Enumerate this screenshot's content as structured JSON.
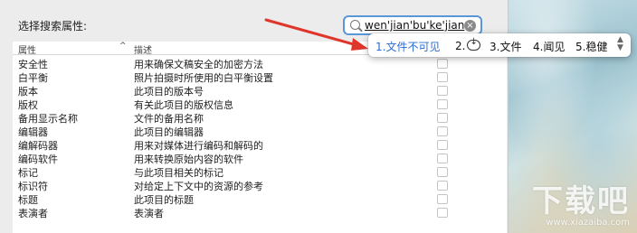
{
  "dialog": {
    "title": "选择搜索属性:",
    "search": {
      "query": "wen'jian'bu'ke'jian"
    },
    "table": {
      "columns": [
        "属性",
        "描述"
      ],
      "sort_glyph": "^",
      "rows": [
        {
          "attr": "安全性",
          "desc": "用来确保文稿安全的加密方法"
        },
        {
          "attr": "白平衡",
          "desc": "照片拍摄时所使用的白平衡设置"
        },
        {
          "attr": "版本",
          "desc": "此项目的版本号"
        },
        {
          "attr": "版权",
          "desc": "有关此项目的版权信息"
        },
        {
          "attr": "备用显示名称",
          "desc": "文件的备用名称"
        },
        {
          "attr": "编辑器",
          "desc": "此项目的编辑器"
        },
        {
          "attr": "编解码器",
          "desc": "用来对媒体进行编码和解码的"
        },
        {
          "attr": "编码软件",
          "desc": "用来转换原始内容的软件"
        },
        {
          "attr": "标记",
          "desc": "与此项目相关的标记"
        },
        {
          "attr": "标识符",
          "desc": "对给定上下文中的资源的参考"
        },
        {
          "attr": "标题",
          "desc": "此项目的标题"
        },
        {
          "attr": "表演者",
          "desc": "表演者"
        }
      ]
    }
  },
  "ime": {
    "candidates": [
      {
        "label": "1.文件不可见",
        "selected": true
      },
      {
        "label": "2.",
        "icon": "cloud-download-icon",
        "selected": false
      },
      {
        "label": "3.文件",
        "selected": false
      },
      {
        "label": "4.闻见",
        "selected": false
      },
      {
        "label": "5.稳健",
        "selected": false
      }
    ],
    "pager_icon": "up-down-chevron-icon"
  },
  "watermark": {
    "logo": "下载吧",
    "url": "www.xiazaiba.com"
  },
  "colors": {
    "accent": "#2a6ed6",
    "arrow": "#e0352b",
    "search_border": "#5a97d8"
  }
}
